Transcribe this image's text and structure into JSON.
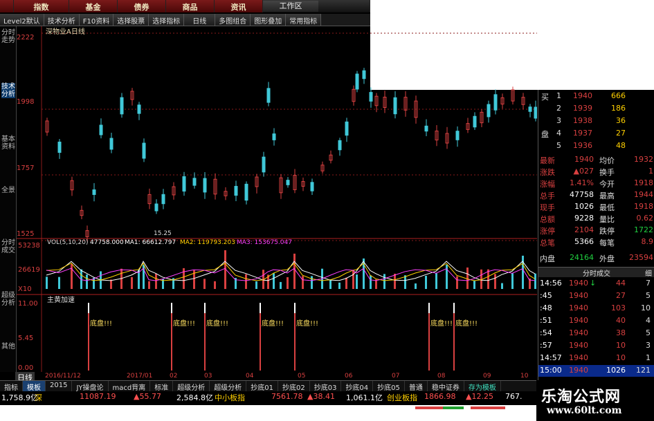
{
  "menu": {
    "items": [
      "指数",
      "基金",
      "债券",
      "商品",
      "资讯"
    ],
    "workarea": "工作区"
  },
  "toolbar": {
    "items": [
      "Level2默认",
      "技术分析",
      "F10资料",
      "选择股票",
      "选择指标",
      "日线",
      "多图组合",
      "图形叠加",
      "常用指标"
    ]
  },
  "vertical_tabs": [
    "分时走势",
    "技术分析",
    "基本资料",
    "全景",
    "分时成交",
    "超级分析",
    "其他"
  ],
  "chart": {
    "title": "深物业A日线",
    "price_ticks": [
      "2222",
      "1998",
      "1757",
      "1525"
    ],
    "low_label": "15.25",
    "vol_header": {
      "label": "VOL(5,10,20)",
      "vol": "47758.000",
      "ma1": "MA1: 66612.797",
      "ma2": "MA2: 119793.203",
      "ma3": "MA3: 153675.047"
    },
    "vol_ticks": [
      "53238",
      "26619",
      "X10"
    ],
    "indicator_title": "主黄加速",
    "indicator_ticks": [
      "11.00",
      "5.45",
      "0.00"
    ],
    "signal_text": "底盘!!!",
    "date_labels": [
      "2016/11/12",
      "2017/01",
      "02",
      "03",
      "04",
      "05",
      "06",
      "07",
      "08",
      "09",
      "10"
    ],
    "period_label": "日线"
  },
  "colors": {
    "up": "#d94040",
    "down": "#40c8d8",
    "ma1": "#ffffff",
    "ma2": "#ffd000",
    "ma3": "#ff40ff",
    "signal": "#ffe060",
    "grid": "#8a1a1a",
    "price_label": "#d94040"
  },
  "right_panel": {
    "bids": [
      {
        "label": "买",
        "n": "1",
        "price": "1940",
        "qty": "666"
      },
      {
        "label": "",
        "n": "2",
        "price": "1939",
        "qty": "186"
      },
      {
        "label": "",
        "n": "3",
        "price": "1938",
        "qty": "36"
      },
      {
        "label": "盘",
        "n": "4",
        "price": "1937",
        "qty": "27"
      },
      {
        "label": "",
        "n": "5",
        "price": "1936",
        "qty": "48"
      }
    ],
    "quote": [
      {
        "k1": "最新",
        "v1": "1940",
        "k2": "均价",
        "v2": "1932"
      },
      {
        "k1": "涨跌",
        "v1": "▲027",
        "k2": "换手",
        "v2": "1"
      },
      {
        "k1": "涨幅",
        "v1": "1.41%",
        "k2": "今开",
        "v2": "1918"
      },
      {
        "k1": "总手",
        "v1": "47758",
        "k2": "最高",
        "v2": "1944"
      },
      {
        "k1": "现手",
        "v1": "1026",
        "k2": "最低",
        "v2": "1918"
      },
      {
        "k1": "总额",
        "v1": "9228",
        "k2": "量比",
        "v2": "0.62"
      },
      {
        "k1": "涨停",
        "v1": "2104",
        "k2": "跌停",
        "v2": "1722"
      },
      {
        "k1": "总笔",
        "v1": "5366",
        "k2": "每笔",
        "v2": "8.9"
      }
    ],
    "inner_outer": {
      "k1": "内盘",
      "v1": "24164",
      "k2": "外盘",
      "v2": "23594"
    },
    "ticks_title": "分时成交",
    "ticks_tab": "细",
    "ticks": [
      {
        "time": "14:56",
        "price": "1940",
        "arrow": "↓",
        "vol": "44",
        "n": "7"
      },
      {
        "time": ":45",
        "price": "1940",
        "arrow": "",
        "vol": "27",
        "n": "5"
      },
      {
        "time": ":48",
        "price": "1940",
        "arrow": "",
        "vol": "103",
        "n": "10"
      },
      {
        "time": ":51",
        "price": "1940",
        "arrow": "",
        "vol": "40",
        "n": "4"
      },
      {
        "time": ":54",
        "price": "1940",
        "arrow": "",
        "vol": "38",
        "n": "5"
      },
      {
        "time": ":57",
        "price": "1940",
        "arrow": "",
        "vol": "10",
        "n": "3"
      },
      {
        "time": "14:57",
        "price": "1940",
        "arrow": "",
        "vol": "10",
        "n": "1"
      },
      {
        "time": "15:00",
        "price": "1940",
        "arrow": "",
        "vol": "1026",
        "n": "121"
      }
    ]
  },
  "bottom_tabs": [
    "指标",
    "模板",
    "2015",
    "JY操盘论",
    "macd背离",
    "标准",
    "超级分析",
    "超级分析",
    "抄底01",
    "抄底02",
    "抄底03",
    "抄底04",
    "抄底05",
    "普通",
    "稳中证券",
    "存为模板"
  ],
  "ticker": [
    {
      "text": "1,758.9亿",
      "color": "#ffffff"
    },
    {
      "text": "深",
      "color": "#ffd000"
    },
    {
      "text": "11087.19",
      "color": "#ff5050"
    },
    {
      "text": "▲55.77",
      "color": "#ff5050"
    },
    {
      "text": "2,584.8亿",
      "color": "#ffffff"
    },
    {
      "text": "中小板指",
      "color": "#ffd000"
    },
    {
      "text": "7561.78",
      "color": "#ff5050"
    },
    {
      "text": "▲38.41",
      "color": "#ff5050"
    },
    {
      "text": "1,061.1亿",
      "color": "#ffffff"
    },
    {
      "text": "创业板指",
      "color": "#ffd000"
    },
    {
      "text": "1866.98",
      "color": "#ff5050"
    },
    {
      "text": "▲12.25",
      "color": "#ff5050"
    },
    {
      "text": "767.",
      "color": "#ffffff"
    }
  ],
  "logo": {
    "cn": "乐淘公式网",
    "url": "www.60lt.com"
  }
}
